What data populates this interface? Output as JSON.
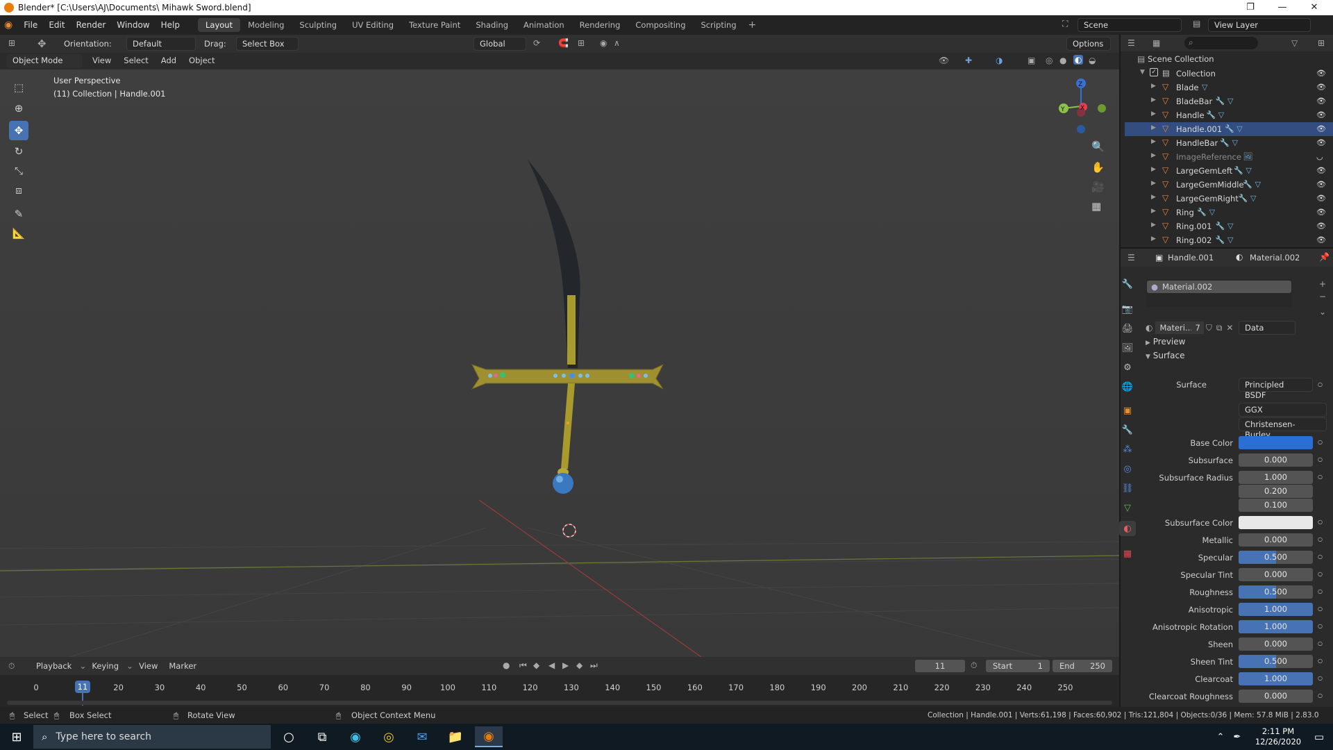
{
  "window": {
    "title": "Blender* [C:\\Users\\AJ\\Documents\\ Mihawk Sword.blend]"
  },
  "menu": [
    "File",
    "Edit",
    "Render",
    "Window",
    "Help"
  ],
  "workspaces": [
    "Layout",
    "Modeling",
    "Sculpting",
    "UV Editing",
    "Texture Paint",
    "Shading",
    "Animation",
    "Rendering",
    "Compositing",
    "Scripting"
  ],
  "active_workspace": "Layout",
  "scene": {
    "label": "Scene",
    "view_layer": "View Layer"
  },
  "tool_header": {
    "orientation_label": "Orientation:",
    "orientation_value": "Default",
    "drag_label": "Drag:",
    "drag_value": "Select Box",
    "transform_orientation": "Global",
    "options": "Options"
  },
  "viewport_header": {
    "mode": "Object Mode",
    "menus": [
      "View",
      "Select",
      "Add",
      "Object"
    ]
  },
  "viewport": {
    "overlay_line1": "User Perspective",
    "overlay_line2": "(11) Collection | Handle.001",
    "gizmo_axes": {
      "x": "X",
      "y": "Y",
      "z": "Z"
    }
  },
  "outliner": {
    "root": "Scene Collection",
    "collection": "Collection",
    "items": [
      {
        "name": "Blade",
        "mods": "▽"
      },
      {
        "name": "BladeBar",
        "mods": "🔧 ▽"
      },
      {
        "name": "Handle",
        "mods": "🔧 ▽"
      },
      {
        "name": "Handle.001",
        "mods": "🔧 ▽"
      },
      {
        "name": "HandleBar",
        "mods": "🔧 ▽"
      },
      {
        "name": "ImageReference",
        "mods": "🖼"
      },
      {
        "name": "LargeGemLeft",
        "mods": "🔧 ▽"
      },
      {
        "name": "LargeGemMiddle",
        "mods": "🔧 ▽"
      },
      {
        "name": "LargeGemRight",
        "mods": "🔧 ▽"
      },
      {
        "name": "Ring",
        "mods": "🔧 ▽"
      },
      {
        "name": "Ring.001",
        "mods": "🔧 ▽"
      },
      {
        "name": "Ring.002",
        "mods": "🔧 ▽"
      }
    ]
  },
  "properties": {
    "object_name": "Handle.001",
    "material_name": "Material.002",
    "slot_name": "Material.002",
    "material_short": "Materi...",
    "user_count": "7",
    "link": "Data",
    "panels": {
      "preview": "Preview",
      "surface": "Surface"
    },
    "surface_label": "Surface",
    "surface_value": "Principled BSDF",
    "distribution": "GGX",
    "subsurface_method": "Christensen-Burley",
    "fields": [
      {
        "label": "Base Color",
        "value": "",
        "fill": 1.0,
        "kind": "color",
        "color": "#2a6fd6"
      },
      {
        "label": "Subsurface",
        "value": "0.000",
        "fill": 0.0
      },
      {
        "label": "Subsurface Radius",
        "value": "1.000",
        "fill": 0.0
      },
      {
        "label": "",
        "value": "0.200",
        "fill": 0.0
      },
      {
        "label": "",
        "value": "0.100",
        "fill": 0.0
      },
      {
        "label": "Subsurface Color",
        "value": "",
        "fill": 1.0,
        "kind": "color",
        "color": "#e8e8e8"
      },
      {
        "label": "Metallic",
        "value": "0.000",
        "fill": 0.0
      },
      {
        "label": "Specular",
        "value": "0.500",
        "fill": 0.5
      },
      {
        "label": "Specular Tint",
        "value": "0.000",
        "fill": 0.0
      },
      {
        "label": "Roughness",
        "value": "0.500",
        "fill": 0.5
      },
      {
        "label": "Anisotropic",
        "value": "1.000",
        "fill": 1.0
      },
      {
        "label": "Anisotropic Rotation",
        "value": "1.000",
        "fill": 1.0
      },
      {
        "label": "Sheen",
        "value": "0.000",
        "fill": 0.0
      },
      {
        "label": "Sheen Tint",
        "value": "0.500",
        "fill": 0.5
      },
      {
        "label": "Clearcoat",
        "value": "1.000",
        "fill": 1.0
      },
      {
        "label": "Clearcoat Roughness",
        "value": "0.000",
        "fill": 0.0
      }
    ]
  },
  "timeline": {
    "menus": [
      "Playback",
      "Keying",
      "View",
      "Marker"
    ],
    "current_frame": "11",
    "start_label": "Start",
    "start": "1",
    "end_label": "End",
    "end": "250",
    "ticks": [
      "0",
      "20",
      "30",
      "40",
      "50",
      "60",
      "70",
      "80",
      "90",
      "100",
      "110",
      "120",
      "130",
      "140",
      "150",
      "160",
      "170",
      "180",
      "190",
      "200",
      "210",
      "220",
      "230",
      "240",
      "250"
    ]
  },
  "statusbar": {
    "select": "Select",
    "box_select": "Box Select",
    "rotate_view": "Rotate View",
    "context_menu": "Object Context Menu",
    "stats": "Collection | Handle.001 | Verts:61,198 | Faces:60,902 | Tris:121,804 | Objects:0/36 | Mem: 57.8 MiB | 2.83.0"
  },
  "taskbar": {
    "search_placeholder": "Type here to search",
    "time": "2:11 PM",
    "date": "12/26/2020"
  }
}
